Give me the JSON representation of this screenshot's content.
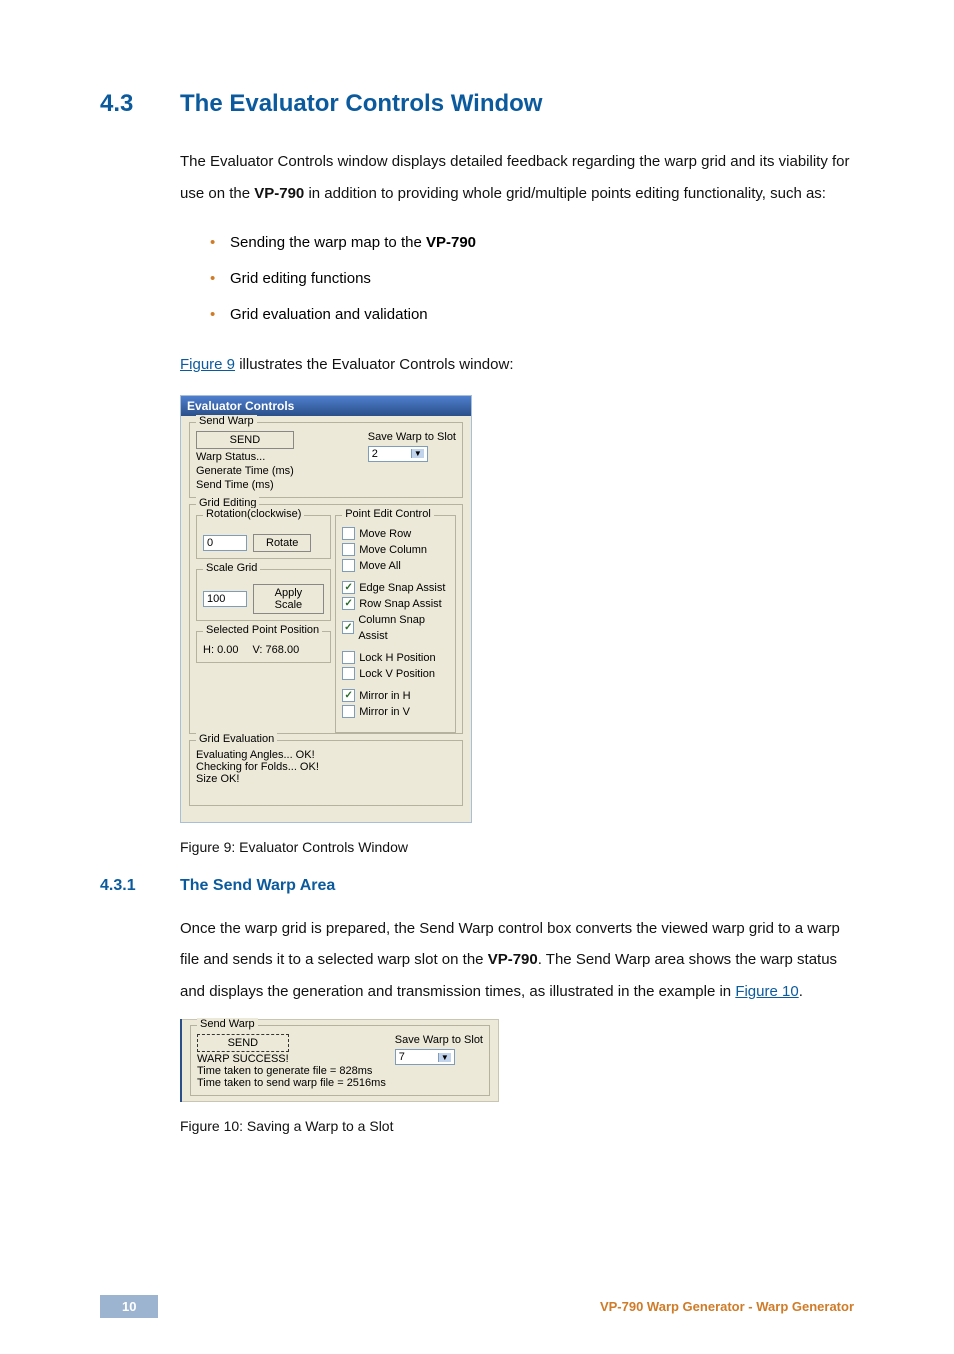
{
  "section": {
    "num": "4.3",
    "title": "The Evaluator Controls Window"
  },
  "intro": {
    "p1_a": "The Evaluator Controls window displays detailed feedback regarding the warp grid and its viability for use on the ",
    "p1_bold": "VP-790",
    "p1_b": " in addition to providing whole grid/multiple points editing functionality, such as:",
    "bullets": {
      "b1_a": "Sending the warp map to the ",
      "b1_bold": "VP-790",
      "b2": "Grid editing functions",
      "b3": "Grid evaluation and validation"
    },
    "fig9_link": "Figure 9",
    "fig9_after": " illustrates the Evaluator Controls window:"
  },
  "fig9": {
    "window_title": "Evaluator Controls",
    "sendwarp": {
      "legend": "Send Warp",
      "send_btn": "SEND",
      "status": "Warp Status...",
      "gen_time": "Generate Time (ms)",
      "send_time": "Send Time (ms)",
      "save_label": "Save Warp to Slot",
      "slot_value": "2"
    },
    "grid_editing": {
      "legend": "Grid Editing",
      "rotation": {
        "legend": "Rotation(clockwise)",
        "value": "0",
        "btn": "Rotate"
      },
      "scale": {
        "legend": "Scale Grid",
        "value": "100",
        "btn": "Apply Scale"
      },
      "selpos": {
        "legend": "Selected Point Position",
        "h_label": "H:",
        "h_val": "0.00",
        "v_label": "V:",
        "v_val": "768.00"
      }
    },
    "point_edit": {
      "legend": "Point Edit Control",
      "move_row": "Move Row",
      "move_col": "Move Column",
      "move_all": "Move All",
      "edge_snap": "Edge Snap Assist",
      "row_snap": "Row Snap Assist",
      "col_snap": "Column Snap Assist",
      "lock_h": "Lock H Position",
      "lock_v": "Lock V Position",
      "mirror_h": "Mirror in H",
      "mirror_v": "Mirror in V"
    },
    "grid_eval": {
      "legend": "Grid Evaluation",
      "l1": "Evaluating Angles... OK!",
      "l2": "Checking for Folds... OK!",
      "l3": "Size OK!"
    },
    "caption": "Figure 9: Evaluator Controls Window"
  },
  "subsection": {
    "num": "4.3.1",
    "title": "The Send Warp Area"
  },
  "sendwarp_para": {
    "a": "Once the warp grid is prepared, the Send Warp control box converts the viewed warp grid to a warp file and sends it to a selected warp slot on the ",
    "bold": "VP-790",
    "b": ". The Send Warp area shows the warp status and displays the generation and transmission times, as illustrated in the example in ",
    "link": "Figure 10",
    "c": "."
  },
  "fig10": {
    "legend": "Send Warp",
    "send_btn": "SEND",
    "status": "WARP SUCCESS!",
    "gen_line": "Time taken to generate file = 828ms",
    "send_line": "Time taken to send warp file = 2516ms",
    "save_label": "Save Warp to Slot",
    "slot_value": "7",
    "caption": "Figure 10: Saving a Warp to a Slot"
  },
  "footer": {
    "page": "10",
    "title": "VP-790 Warp Generator - Warp Generator"
  }
}
